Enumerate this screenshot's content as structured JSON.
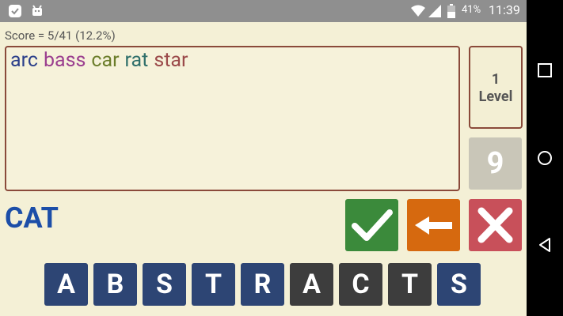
{
  "status_bar": {
    "battery_text": "41%",
    "time": "11:39"
  },
  "game": {
    "score_text": "Score = 5/41 (12.2%)",
    "found_words": [
      {
        "text": "arc",
        "color": "#2b3f8a"
      },
      {
        "text": "bass",
        "color": "#9b3f8f"
      },
      {
        "text": "car",
        "color": "#6b7d2a"
      },
      {
        "text": "rat",
        "color": "#2f6f6a"
      },
      {
        "text": "star",
        "color": "#9b4a4a"
      }
    ],
    "level_number": "1",
    "level_label": "Level",
    "remaining_count": "9",
    "current_word": "CAT",
    "letters": [
      "A",
      "B",
      "S",
      "T",
      "R",
      "A",
      "C",
      "T",
      "S"
    ]
  }
}
